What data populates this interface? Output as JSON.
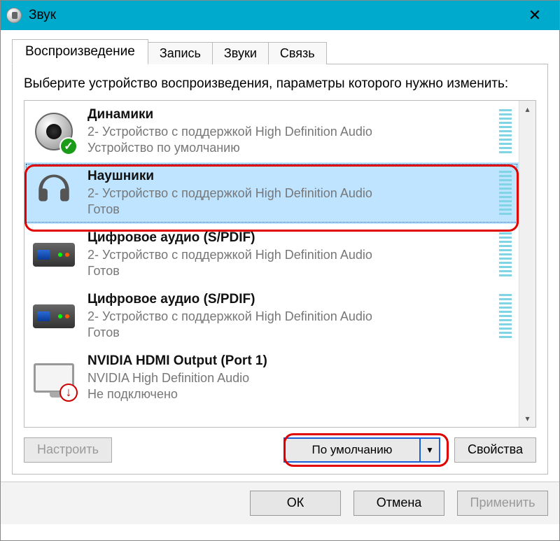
{
  "window": {
    "title": "Звук"
  },
  "tabs": [
    {
      "label": "Воспроизведение"
    },
    {
      "label": "Запись"
    },
    {
      "label": "Звуки"
    },
    {
      "label": "Связь"
    }
  ],
  "instruction": "Выберите устройство воспроизведения, параметры которого нужно изменить:",
  "devices": [
    {
      "name": "Динамики",
      "sub": "2- Устройство с поддержкой High Definition Audio",
      "status": "Устройство по умолчанию"
    },
    {
      "name": "Наушники",
      "sub": "2- Устройство с поддержкой High Definition Audio",
      "status": "Готов"
    },
    {
      "name": "Цифровое аудио (S/PDIF)",
      "sub": "2- Устройство с поддержкой High Definition Audio",
      "status": "Готов"
    },
    {
      "name": "Цифровое аудио (S/PDIF)",
      "sub": "2- Устройство с поддержкой High Definition Audio",
      "status": "Готов"
    },
    {
      "name": "NVIDIA HDMI Output (Port 1)",
      "sub": "NVIDIA High Definition Audio",
      "status": "Не подключено"
    }
  ],
  "buttons": {
    "configure": "Настроить",
    "set_default": "По умолчанию",
    "properties": "Свойства",
    "ok": "ОК",
    "cancel": "Отмена",
    "apply": "Применить"
  }
}
